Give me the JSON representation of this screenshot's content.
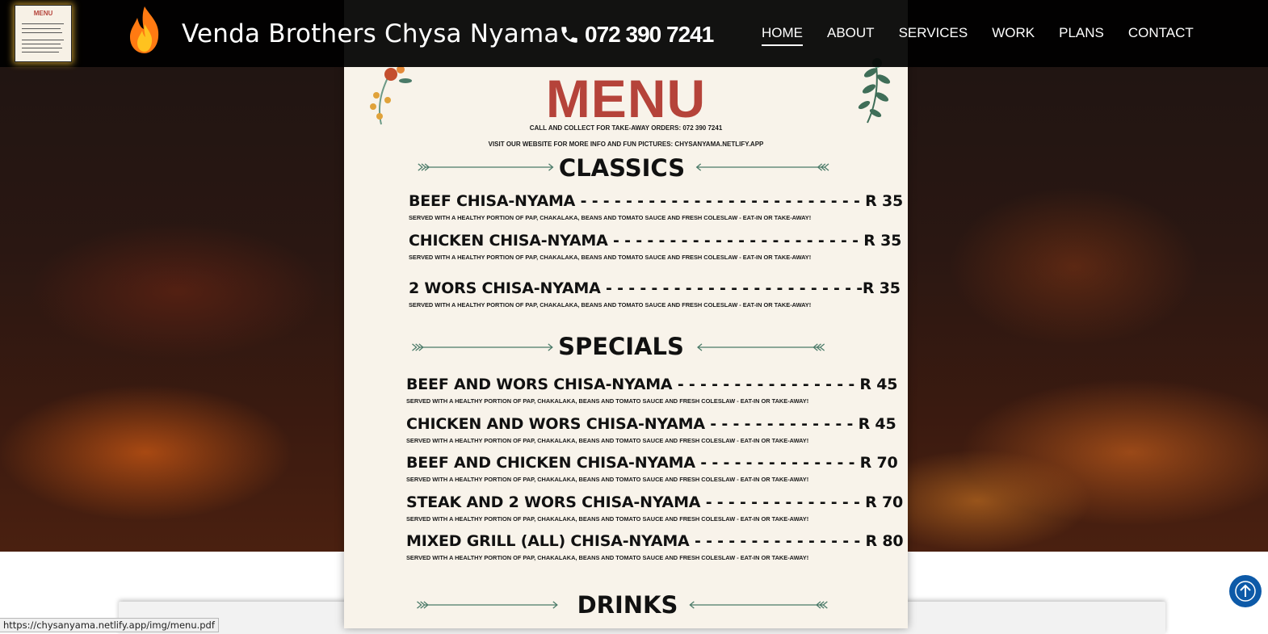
{
  "brand": {
    "name": "Venda Brothers Chysa Nyama",
    "phone": "072 390 7241",
    "icons": {
      "logo": "flame-icon",
      "phone": "phone-icon",
      "thumbnail": "menu-thumbnail"
    }
  },
  "thumbnail": {
    "title": "MENU"
  },
  "nav": {
    "items": [
      {
        "label": "HOME",
        "active": true
      },
      {
        "label": "ABOUT"
      },
      {
        "label": "SERVICES"
      },
      {
        "label": "WORK"
      },
      {
        "label": "PLANS"
      },
      {
        "label": "CONTACT"
      }
    ]
  },
  "menu": {
    "title": "MENU",
    "line1": "CALL AND COLLECT FOR TAKE-AWAY ORDERS: 072 390 7241",
    "line2": "VISIT OUR WEBSITE FOR MORE INFO AND FUN PICTURES: CHYSANYAMA.NETLIFY.APP",
    "sections": [
      {
        "title": "CLASSICS",
        "items": [
          {
            "name": "BEEF CHISA-NYAMA - - - - - - - - - - - - - - - - - - - - - - - - - R 35",
            "desc": "SERVED WITH A HEALTHY PORTION OF PAP, CHAKALAKA, BEANS AND TOMATO SAUCE AND FRESH COLESLAW - EAT-IN OR TAKE-AWAY!"
          },
          {
            "name": "CHICKEN CHISA-NYAMA - - - - - - - - - - - - - - - - - - - - - - R 35",
            "desc": "SERVED WITH A HEALTHY PORTION OF PAP, CHAKALAKA, BEANS AND TOMATO SAUCE AND FRESH COLESLAW - EAT-IN OR TAKE-AWAY!"
          },
          {
            "name": "2 WORS CHISA-NYAMA - - - - - - - - - - - - - - - - - - - - - - -R 35",
            "desc": "SERVED WITH A HEALTHY PORTION OF PAP, CHAKALAKA, BEANS AND TOMATO SAUCE AND FRESH COLESLAW - EAT-IN OR TAKE-AWAY!"
          }
        ]
      },
      {
        "title": "SPECIALS",
        "items": [
          {
            "name": "BEEF AND WORS CHISA-NYAMA  - - - - - - - - - - - - - - - - R 45",
            "desc": "SERVED WITH A HEALTHY PORTION OF PAP, CHAKALAKA, BEANS AND TOMATO SAUCE AND FRESH COLESLAW - EAT-IN OR TAKE-AWAY!"
          },
          {
            "name": "CHICKEN AND WORS CHISA-NYAMA  - - - - - - - - - - - - - R 45",
            "desc": "SERVED WITH A HEALTHY PORTION OF PAP, CHAKALAKA, BEANS AND TOMATO SAUCE AND FRESH COLESLAW - EAT-IN OR TAKE-AWAY!"
          },
          {
            "name": "BEEF AND CHICKEN CHISA-NYAMA  - - - - - - - - - - - - - - R 70",
            "desc": "SERVED WITH A HEALTHY PORTION OF PAP, CHAKALAKA, BEANS AND TOMATO SAUCE AND FRESH COLESLAW - EAT-IN OR TAKE-AWAY!"
          },
          {
            "name": "STEAK AND 2 WORS CHISA-NYAMA - - - - - - - - - - - - - - R 70",
            "desc": "SERVED WITH A HEALTHY PORTION OF PAP, CHAKALAKA, BEANS AND TOMATO SAUCE AND FRESH COLESLAW - EAT-IN OR TAKE-AWAY!"
          },
          {
            "name": "MIXED GRILL (ALL) CHISA-NYAMA - - - - - - - - - - - - - - - R 80",
            "desc": "SERVED WITH A HEALTHY PORTION OF PAP, CHAKALAKA, BEANS AND TOMATO SAUCE AND FRESH COLESLAW - EAT-IN OR TAKE-AWAY!"
          }
        ]
      },
      {
        "title": "DRINKS",
        "items": []
      }
    ]
  },
  "status_url": "https://chysanyama.netlify.app/img/menu.pdf",
  "colors": {
    "menu_title": "#b5433a",
    "accent_blue": "#0d5aa8",
    "arrow_green": "#4a7a68"
  },
  "scroll_top": {
    "icon": "arrow-up-icon"
  }
}
